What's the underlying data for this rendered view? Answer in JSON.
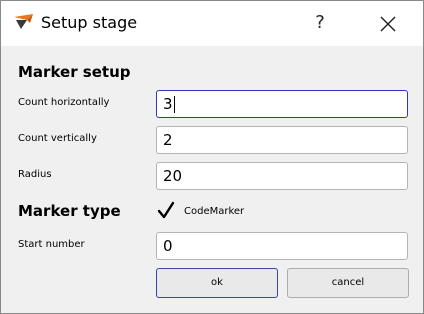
{
  "window": {
    "title": "Setup stage",
    "help_glyph": "?",
    "icon": "app-logo-icon",
    "close_icon": "close-icon"
  },
  "marker_setup": {
    "heading": "Marker setup",
    "count_horizontally": {
      "label": "Count horizontally",
      "value": "3"
    },
    "count_vertically": {
      "label": "Count vertically",
      "value": "2"
    },
    "radius": {
      "label": "Radius",
      "value": "20"
    }
  },
  "marker_type": {
    "heading": "Marker type",
    "codemarker": {
      "label": "CodeMarker",
      "checked": true
    },
    "start_number": {
      "label": "Start number",
      "value": "0"
    }
  },
  "buttons": {
    "ok": "ok",
    "cancel": "cancel"
  },
  "colors": {
    "focus_border": "#2d3ab8",
    "logo_orange": "#e8761b",
    "logo_dark": "#3a3a3a"
  }
}
